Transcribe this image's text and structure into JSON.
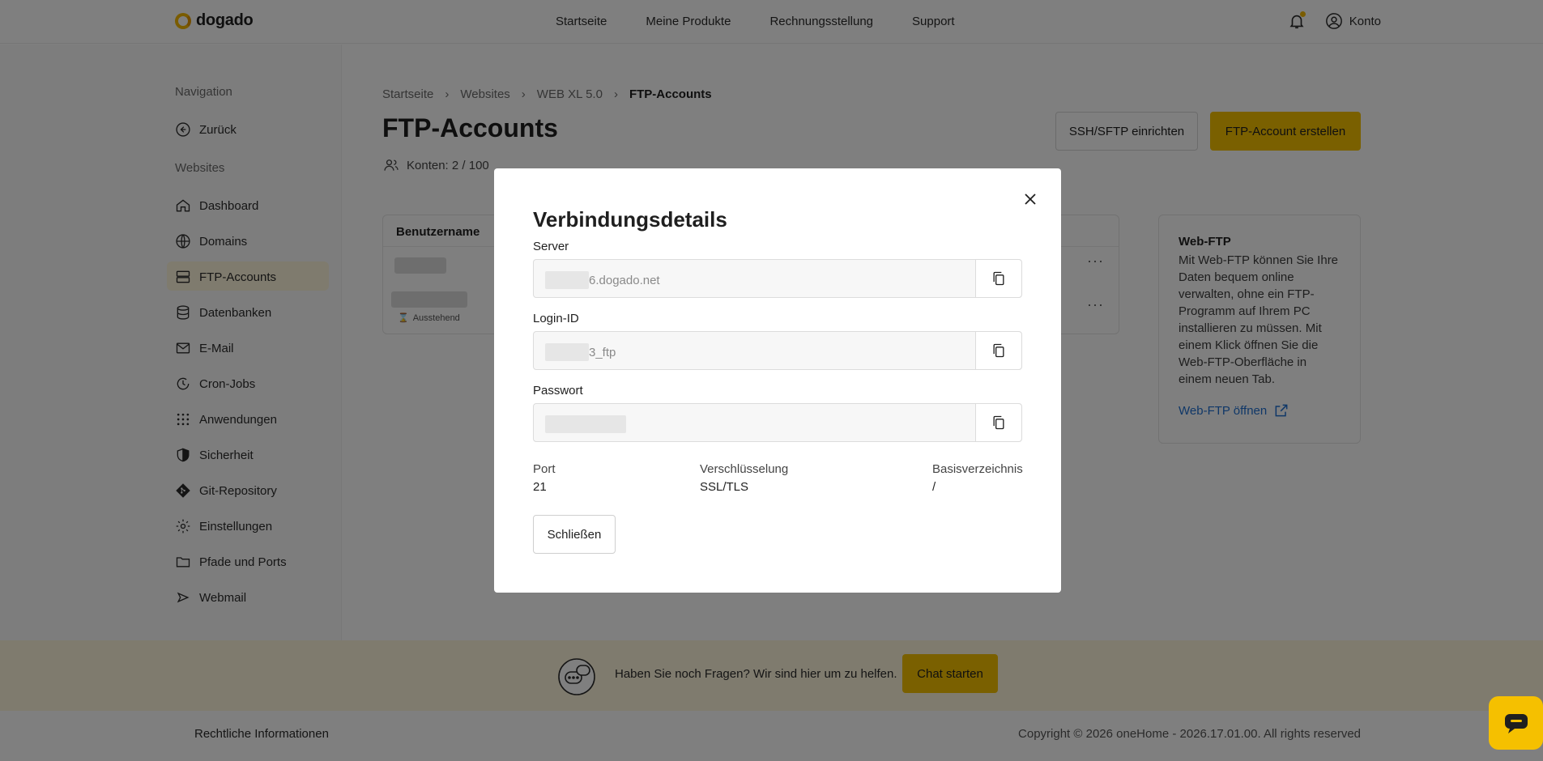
{
  "brand": {
    "name": "dogado",
    "accent": "#f5c000"
  },
  "topnav": {
    "items": [
      "Startseite",
      "Meine Produkte",
      "Rechnungsstellung",
      "Support"
    ],
    "account_label": "Konto"
  },
  "sidebar": {
    "section_nav": "Navigation",
    "back_label": "Zurück",
    "section_websites": "Websites",
    "items": [
      {
        "label": "Dashboard",
        "icon": "home-icon"
      },
      {
        "label": "Domains",
        "icon": "globe-icon"
      },
      {
        "label": "FTP-Accounts",
        "icon": "server-icon"
      },
      {
        "label": "Datenbanken",
        "icon": "database-icon"
      },
      {
        "label": "E-Mail",
        "icon": "mail-icon"
      },
      {
        "label": "Cron-Jobs",
        "icon": "clock-icon"
      },
      {
        "label": "Anwendungen",
        "icon": "grid-icon"
      },
      {
        "label": "Sicherheit",
        "icon": "shield-icon"
      },
      {
        "label": "Git-Repository",
        "icon": "git-icon"
      },
      {
        "label": "Einstellungen",
        "icon": "gear-icon"
      },
      {
        "label": "Pfade und Ports",
        "icon": "folder-icon"
      },
      {
        "label": "Webmail",
        "icon": "send-icon"
      }
    ]
  },
  "breadcrumb": [
    "Startseite",
    "Websites",
    "WEB XL 5.0",
    "FTP-Accounts"
  ],
  "page": {
    "title": "FTP-Accounts",
    "konten": "Konten: 2 / 100",
    "btn_ssh": "SSH/SFTP einrichten",
    "btn_create": "FTP-Account erstellen",
    "table_header": "Benutzername",
    "pending_label": "Ausstehend"
  },
  "webftp": {
    "title": "Web-FTP",
    "text": "Mit Web-FTP können Sie Ihre Daten bequem online verwalten, ohne ein FTP-Programm auf Ihrem PC installieren zu müssen. Mit einem Klick öffnen Sie die Web-FTP-Oberfläche in einem neuen Tab.",
    "link": "Web-FTP öffnen"
  },
  "help": {
    "text": "Haben Sie noch Fragen? Wir sind hier um zu helfen.",
    "button": "Chat starten"
  },
  "footer": {
    "left": "Rechtliche Informationen",
    "right": "Copyright © 2026 oneHome - 2026.17.01.00. All rights reserved"
  },
  "modal": {
    "title": "Verbindungsdetails",
    "server_label": "Server",
    "server_value": "6.dogado.net",
    "login_label": "Login-ID",
    "login_value": "3_ftp",
    "password_label": "Passwort",
    "port_label": "Port",
    "port_value": "21",
    "enc_label": "Verschlüsselung",
    "enc_value": "SSL/TLS",
    "base_label": "Basisverzeichnis",
    "base_value": "/",
    "close_button": "Schließen"
  }
}
